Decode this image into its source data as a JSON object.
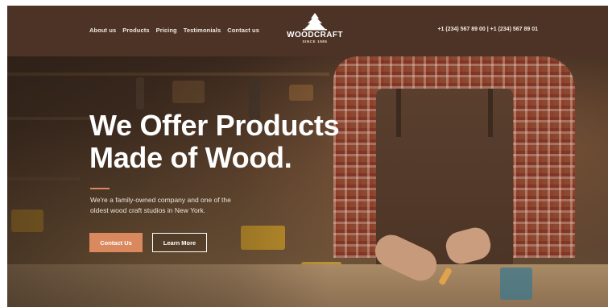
{
  "header": {
    "nav": [
      "About us",
      "Products",
      "Pricing",
      "Testimonials",
      "Contact us"
    ],
    "logo": {
      "name": "WOODCRAFT",
      "since": "SINCE 1985"
    },
    "phones": "+1 (234) 567 89 00 | +1 (234) 567 89 01"
  },
  "hero": {
    "headline_line1": "We Offer Products",
    "headline_line2": "Made of Wood.",
    "subtitle_line1": "We're a family-owned company and one of the",
    "subtitle_line2": "oldest wood craft studios in New York.",
    "primary_button": "Contact Us",
    "secondary_button": "Learn More"
  },
  "colors": {
    "header_bg": "#4d3326",
    "accent": "#d9895d",
    "text_light": "#ffffff"
  }
}
